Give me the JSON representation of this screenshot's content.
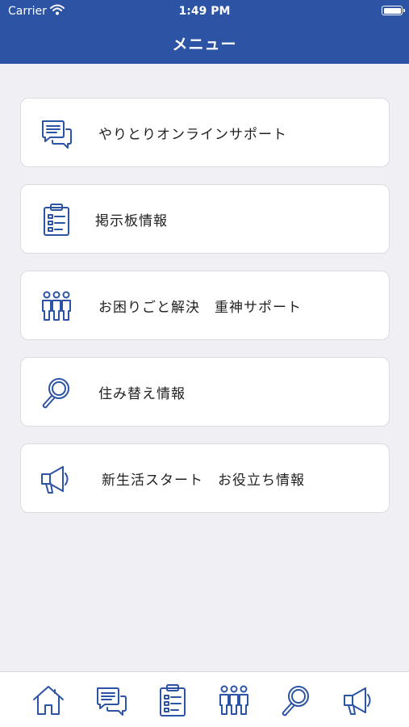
{
  "status_bar": {
    "carrier": "Carrier",
    "time": "1:49 PM"
  },
  "nav": {
    "title": "メニュー"
  },
  "menu": [
    {
      "label": "やりとりオンラインサポート",
      "icon": "chat-bubbles-icon"
    },
    {
      "label": "掲示板情報",
      "icon": "clipboard-icon"
    },
    {
      "label": "お困りごと解決　重神サポート",
      "icon": "people-group-icon"
    },
    {
      "label": "住み替え情報",
      "icon": "search-icon"
    },
    {
      "label": "新生活スタート　お役立ち情報",
      "icon": "megaphone-icon"
    }
  ],
  "tab_bar": [
    "home-icon",
    "chat-bubbles-icon",
    "clipboard-icon",
    "people-group-icon",
    "search-icon",
    "megaphone-icon"
  ],
  "colors": {
    "accent": "#2c53a4",
    "background": "#efeff4",
    "card": "#ffffff"
  }
}
